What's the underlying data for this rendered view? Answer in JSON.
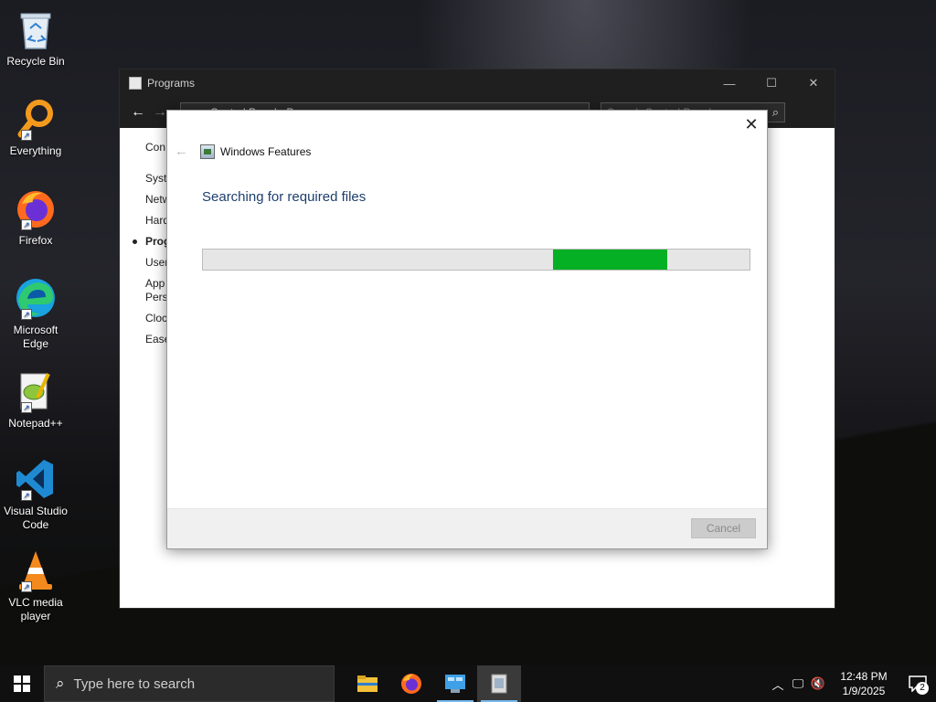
{
  "desktop": {
    "icons": [
      {
        "label": "Recycle Bin",
        "icon": "recycle-bin-icon"
      },
      {
        "label": "Everything",
        "icon": "everything-search-icon"
      },
      {
        "label": "Firefox",
        "icon": "firefox-icon"
      },
      {
        "label": "Microsoft Edge",
        "icon": "edge-icon"
      },
      {
        "label": "Notepad++",
        "icon": "notepadpp-icon"
      },
      {
        "label": "Visual Studio Code",
        "icon": "vscode-icon"
      },
      {
        "label": "VLC media player",
        "icon": "vlc-icon"
      }
    ]
  },
  "control_panel": {
    "title": "Programs",
    "minimize": "—",
    "maximize": "☐",
    "close": "✕",
    "address": "Control Panel  ›  Programs",
    "search_placeholder": "Search Control Panel",
    "sidebar": [
      "Con",
      "Syste",
      "Netw",
      "Hard",
      "Prog",
      "User",
      "App",
      "Pers",
      "Clock",
      "Ease"
    ]
  },
  "windows_features": {
    "title": "Windows Features",
    "status": "Searching for required files",
    "progress_start": 0.64,
    "progress_end": 0.85,
    "cancel_label": "Cancel",
    "accent_color": "#06b025"
  },
  "taskbar": {
    "search_placeholder": "Type here to search",
    "time": "12:48 PM",
    "date": "1/9/2025",
    "notification_count": "2"
  }
}
